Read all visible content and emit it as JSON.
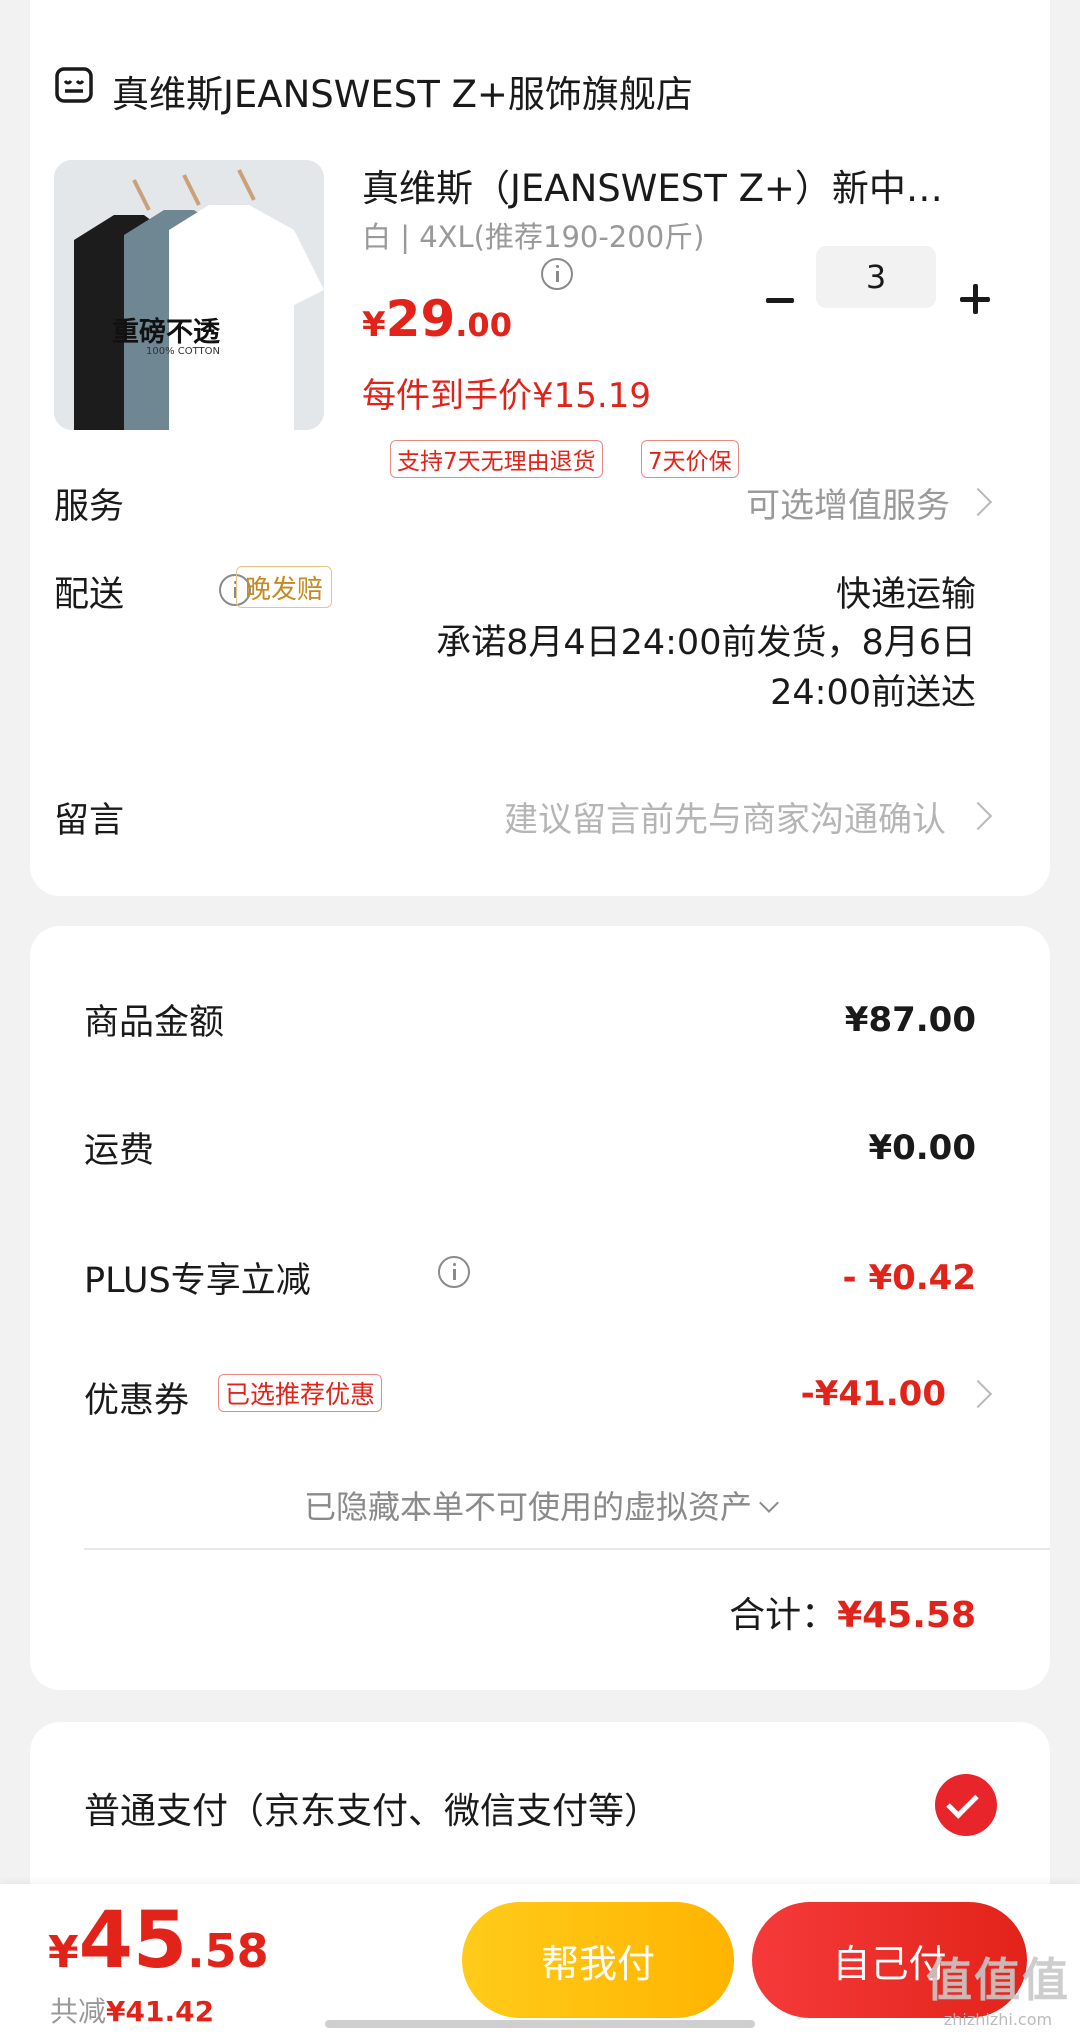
{
  "shop": {
    "name": "真维斯JEANSWEST Z+服饰旗舰店",
    "icon": "shop-icon"
  },
  "product": {
    "title": "真维斯（JEANSWEST Z+）新中…",
    "spec": "白 | 4XL(推荐190-200斤)",
    "image_caption": "重磅不透",
    "image_caption_sub": "100% COTTON",
    "price_currency": "¥",
    "price_int": "29",
    "price_dec": ".00",
    "quantity": "3",
    "unit_price": "每件到手价¥15.19",
    "tags": [
      "支持7天无理由退货",
      "7天价保"
    ]
  },
  "service": {
    "label": "服务",
    "value": "可选增值服务"
  },
  "delivery": {
    "label": "配送",
    "badge": "晚发赔",
    "method": "快递运输",
    "promise": "承诺8月4日24:00前发货，8月6日24:00前送达"
  },
  "message": {
    "label": "留言",
    "placeholder": "建议留言前先与商家沟通确认"
  },
  "price_breakdown": {
    "goods_label": "商品金额",
    "goods_value": "¥87.00",
    "shipping_label": "运费",
    "shipping_value": "¥0.00",
    "plus_label": "PLUS专享立减",
    "plus_value": "- ¥0.42",
    "coupon_label": "优惠券",
    "coupon_badge": "已选推荐优惠",
    "coupon_value": "-¥41.00",
    "hidden_assets": "已隐藏本单不可使用的虚拟资产",
    "total_label": "合计：",
    "total_value": "¥45.58"
  },
  "payment": {
    "method": "普通支付（京东支付、微信支付等）",
    "selected": true
  },
  "bottom": {
    "currency": "¥",
    "price_int": "45",
    "price_dec": ".58",
    "saved_label": "共减",
    "saved_value": "¥41.42",
    "help_pay": "帮我付",
    "self_pay": "自己付"
  },
  "watermark": {
    "main": "值值值",
    "sub": "zhizhizhi.com"
  },
  "colors": {
    "accent_red": "#e2231a",
    "help_yellow": "#ffb400",
    "badge_gold": "#c58a24"
  }
}
